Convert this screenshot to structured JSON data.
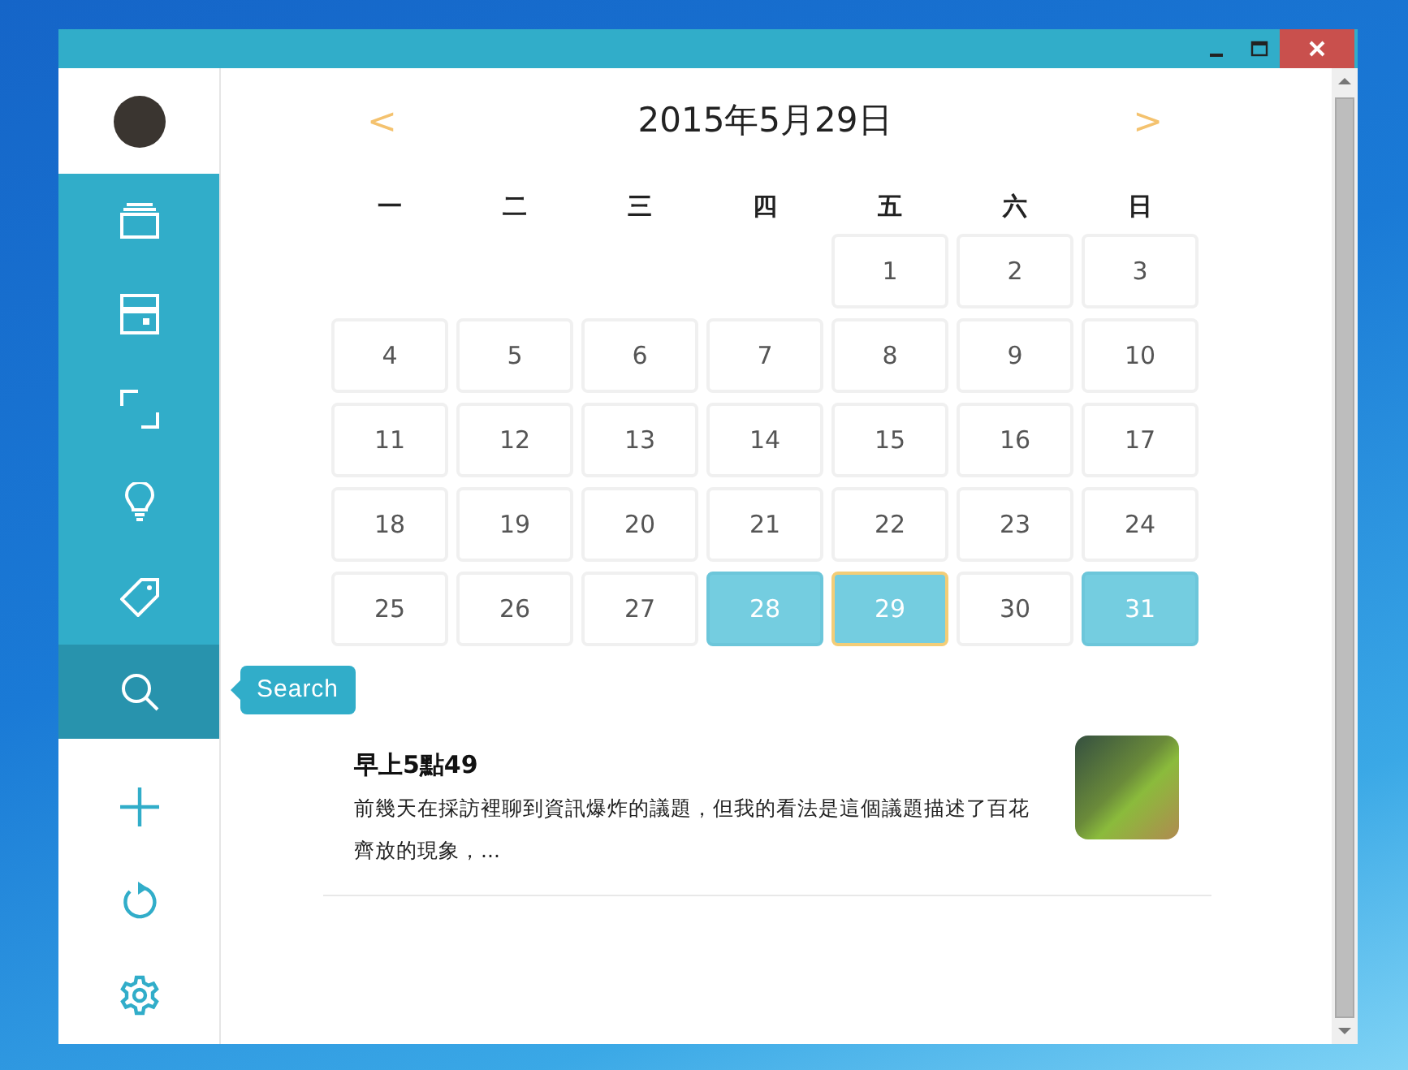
{
  "sidebar": {
    "nav_items": [
      {
        "selected": false
      },
      {
        "selected": false
      },
      {
        "selected": false
      },
      {
        "selected": false
      },
      {
        "selected": false
      },
      {
        "selected": true
      }
    ],
    "tooltip": "Search"
  },
  "calendar": {
    "prev": "<",
    "title": "2015年5月29日",
    "next": ">",
    "weekdays": [
      "一",
      "二",
      "三",
      "四",
      "五",
      "六",
      "日"
    ],
    "weeks": [
      [
        {
          "day": "1",
          "selected": false,
          "has_entry": false
        },
        {
          "day": "2",
          "selected": false,
          "has_entry": false
        },
        {
          "day": "3",
          "selected": false,
          "has_entry": false
        }
      ],
      [
        {
          "day": "4",
          "selected": false,
          "has_entry": false
        },
        {
          "day": "5",
          "selected": false,
          "has_entry": false
        },
        {
          "day": "6",
          "selected": false,
          "has_entry": false
        },
        {
          "day": "7",
          "selected": false,
          "has_entry": false
        },
        {
          "day": "8",
          "selected": false,
          "has_entry": false
        },
        {
          "day": "9",
          "selected": false,
          "has_entry": false
        },
        {
          "day": "10",
          "selected": false,
          "has_entry": false
        }
      ],
      [
        {
          "day": "11",
          "selected": false,
          "has_entry": false
        },
        {
          "day": "12",
          "selected": false,
          "has_entry": false
        },
        {
          "day": "13",
          "selected": false,
          "has_entry": false
        },
        {
          "day": "14",
          "selected": false,
          "has_entry": false
        },
        {
          "day": "15",
          "selected": false,
          "has_entry": false
        },
        {
          "day": "16",
          "selected": false,
          "has_entry": false
        },
        {
          "day": "17",
          "selected": false,
          "has_entry": false
        }
      ],
      [
        {
          "day": "18",
          "selected": false,
          "has_entry": false
        },
        {
          "day": "19",
          "selected": false,
          "has_entry": false
        },
        {
          "day": "20",
          "selected": false,
          "has_entry": false
        },
        {
          "day": "21",
          "selected": false,
          "has_entry": false
        },
        {
          "day": "22",
          "selected": false,
          "has_entry": false
        },
        {
          "day": "23",
          "selected": false,
          "has_entry": false
        },
        {
          "day": "24",
          "selected": false,
          "has_entry": false
        }
      ],
      [
        {
          "day": "25",
          "selected": false,
          "has_entry": false
        },
        {
          "day": "26",
          "selected": false,
          "has_entry": false
        },
        {
          "day": "27",
          "selected": false,
          "has_entry": false
        },
        {
          "day": "28",
          "selected": false,
          "has_entry": true
        },
        {
          "day": "29",
          "selected": true,
          "has_entry": true
        },
        {
          "day": "30",
          "selected": false,
          "has_entry": false
        },
        {
          "day": "31",
          "selected": false,
          "has_entry": true
        }
      ]
    ]
  },
  "entries": [
    {
      "title": "早上5點49",
      "excerpt": "前幾天在採訪裡聊到資訊爆炸的議題，但我的看法是這個議題描述了百花齊放的現象，..."
    }
  ]
}
